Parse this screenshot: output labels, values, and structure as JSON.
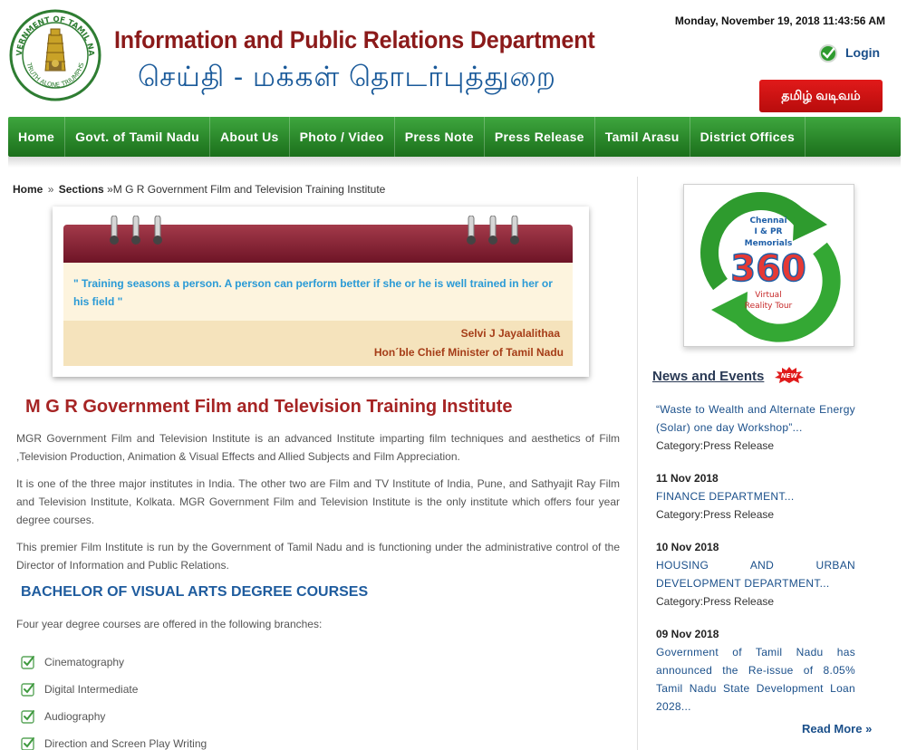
{
  "header": {
    "emblem_top_text": "GOVERNMENT OF TAMIL NADU",
    "emblem_bottom_text": "TRUTH ALONE TRIUMPHS",
    "title_en": "Information and Public Relations Department",
    "title_ta": "செய்தி  -  மக்கள்  தொடர்புத்துறை",
    "datetime": "Monday, November 19, 2018 11:43:56 AM",
    "login_label": "Login",
    "tamil_button": "தமிழ் வடிவம்"
  },
  "nav": {
    "items": [
      "Home",
      "Govt. of Tamil Nadu",
      "About Us",
      "Photo / Video",
      "Press Note",
      "Press Release",
      "Tamil Arasu",
      "District Offices"
    ]
  },
  "breadcrumb": {
    "home": "Home",
    "sep": "»",
    "sections": "Sections",
    "current": "»M G R Government Film and Television Training Institute"
  },
  "quote": {
    "text": "\" Training seasons a person. A person can perform better if she or he is well trained in her or his field \"",
    "author": "Selvi J Jayalalithaa",
    "role": "Hon´ble Chief Minister of Tamil Nadu"
  },
  "main": {
    "title": "M G R Government Film and Television Training Institute",
    "paragraphs": [
      "MGR Government Film and Television Institute is an advanced Institute imparting film techniques and aesthetics of Film ,Television Production, Animation & Visual Effects and Allied Subjects and Film Appreciation.",
      "It is one of the three major institutes in India. The other two are Film and TV Institute of India, Pune, and Sathyajit Ray Film and Television Institute, Kolkata. MGR Government Film and Television Institute is the only institute which offers four year degree courses.",
      "This premier Film Institute is run by the Government of Tamil Nadu and is functioning under the administrative control of the Director of Information and Public Relations."
    ],
    "section_title": "BACHELOR OF VISUAL ARTS DEGREE COURSES",
    "intro": "Four year degree courses are offered in the following branches:",
    "courses": [
      "Cinematography",
      "Digital Intermediate",
      "Audiography",
      "Direction and Screen Play Writing"
    ]
  },
  "sidebar": {
    "banner": {
      "line1": "Chennai",
      "line2": "I & PR",
      "line3": "Memorials",
      "big": "360",
      "line4": "Virtual",
      "line5": "Reality Tour"
    },
    "news_title": "News and Events",
    "new_badge": "NEW",
    "news": [
      {
        "date": "",
        "text": "“Waste to Wealth and Alternate Energy (Solar) one day Workshop”...",
        "category": "Category:Press Release"
      },
      {
        "date": "11 Nov 2018",
        "text": "FINANCE DEPARTMENT...",
        "category": "Category:Press Release"
      },
      {
        "date": "10 Nov 2018",
        "text": "HOUSING AND URBAN DEVELOPMENT DEPARTMENT...",
        "category": "Category:Press Release"
      },
      {
        "date": "09 Nov 2018",
        "text": "Government of Tamil Nadu has announced the Re-issue of 8.05% Tamil Nadu State Development Loan 2028...",
        "category": ""
      }
    ],
    "read_more": "Read More »"
  },
  "colors": {
    "nav_green": "#2e8b2e",
    "title_red": "#8b1a1a",
    "tamil_blue": "#1a5a9a",
    "button_red": "#d01414",
    "quote_blue": "#2a9ad6",
    "link_blue": "#1a4f8a"
  }
}
